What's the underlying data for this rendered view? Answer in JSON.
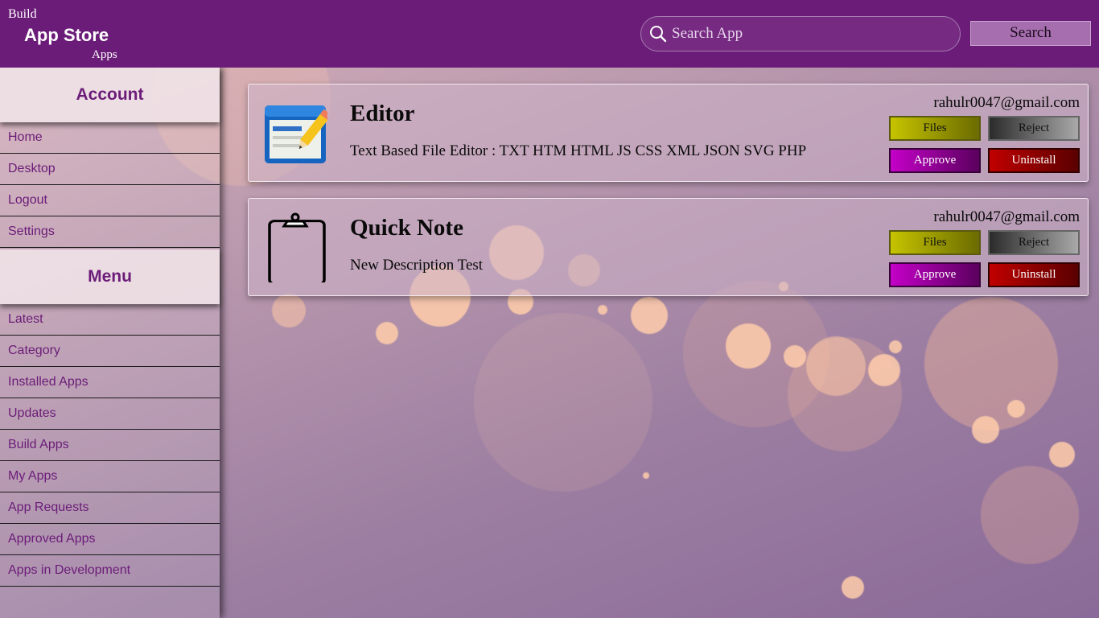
{
  "header": {
    "logo_top": "Build",
    "logo_title": "App Store",
    "logo_bottom": "Apps",
    "search_placeholder": "Search App",
    "search_button": "Search"
  },
  "sidebar": {
    "account_title": "Account",
    "account_items": [
      {
        "label": "Home"
      },
      {
        "label": "Desktop"
      },
      {
        "label": "Logout"
      },
      {
        "label": "Settings"
      }
    ],
    "menu_title": "Menu",
    "menu_items": [
      {
        "label": "Latest"
      },
      {
        "label": "Category"
      },
      {
        "label": "Installed Apps"
      },
      {
        "label": "Updates"
      },
      {
        "label": "Build Apps"
      },
      {
        "label": "My Apps"
      },
      {
        "label": "App Requests"
      },
      {
        "label": "Approved Apps"
      },
      {
        "label": "Apps in Development"
      }
    ]
  },
  "apps": [
    {
      "name": "Editor",
      "description": "Text Based File Editor : TXT HTM HTML JS CSS XML JSON SVG PHP",
      "email": "rahulr0047@gmail.com",
      "icon": "text-editor-icon",
      "buttons": {
        "files": "Files",
        "reject": "Reject",
        "approve": "Approve",
        "uninstall": "Uninstall"
      }
    },
    {
      "name": "Quick Note",
      "description": "New Description Test",
      "email": "rahulr0047@gmail.com",
      "icon": "clipboard-icon",
      "buttons": {
        "files": "Files",
        "reject": "Reject",
        "approve": "Approve",
        "uninstall": "Uninstall"
      }
    }
  ],
  "colors": {
    "header_bg": "#6b1c78",
    "accent_purple": "#6b1c78",
    "files_button": "#c6c400",
    "reject_button": "#2b2b2b",
    "approve_button": "#c400c8",
    "uninstall_button": "#c00000"
  }
}
